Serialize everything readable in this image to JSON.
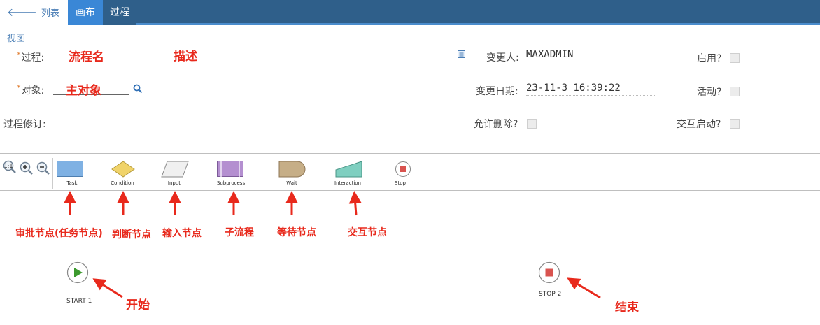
{
  "nav": {
    "back_label": "列表视图",
    "tab_canvas": "画布",
    "tab_process": "过程"
  },
  "form": {
    "process_label": "过程:",
    "process_note": "流程名",
    "desc_note": "描述",
    "object_label": "对象:",
    "object_note": "主对象",
    "revision_label": "过程修订:",
    "changed_by_label": "变更人:",
    "changed_by_value": "MAXADMIN",
    "change_date_label": "变更日期:",
    "change_date_value": "23-11-3 16:39:22",
    "allow_delete_label": "允许删除?",
    "enabled_label": "启用?",
    "active_label": "活动?",
    "interactive_label": "交互启动?"
  },
  "palette": {
    "zoom_reset": "1:1",
    "items": [
      {
        "label": "Task",
        "note": "审批节点(任务节点)"
      },
      {
        "label": "Condition",
        "note": "判断节点"
      },
      {
        "label": "Input",
        "note": "输入节点"
      },
      {
        "label": "Subprocess",
        "note": "子流程"
      },
      {
        "label": "Wait",
        "note": "等待节点"
      },
      {
        "label": "Interaction",
        "note": "交互节点"
      },
      {
        "label": "Stop",
        "note": ""
      }
    ]
  },
  "canvas": {
    "start_label": "START 1",
    "start_note": "开始",
    "stop_label": "STOP 2",
    "stop_note": "结束"
  },
  "colors": {
    "nav_bg": "#2f5f8a",
    "nav_active": "#3a87d6",
    "annotation_red": "#e8291c",
    "task_fill": "#7fb1e3",
    "condition_fill": "#f0d36a",
    "subprocess_fill": "#b48fd0",
    "wait_fill": "#c6ae87",
    "interaction_fill": "#7fcfc0"
  }
}
